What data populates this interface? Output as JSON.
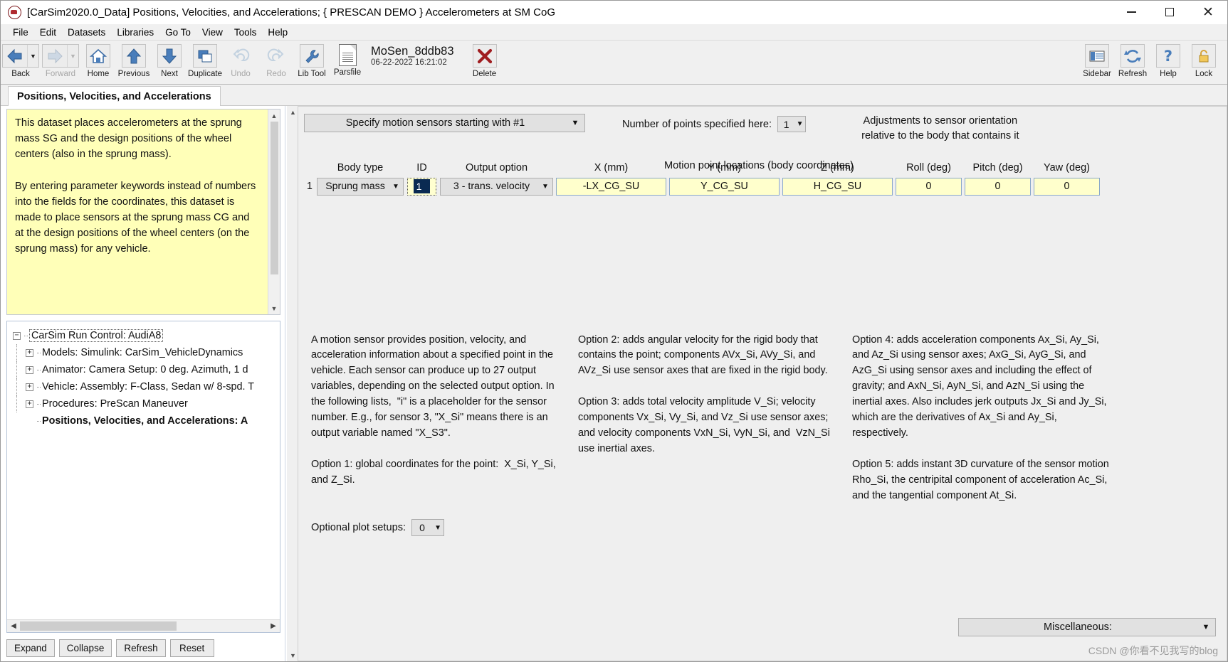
{
  "window": {
    "title": "[CarSim2020.0_Data] Positions, Velocities, and Accelerations; { PRESCAN DEMO } Accelerometers at SM CoG",
    "app_icon": "carsim-icon",
    "minimize": "minimize-icon",
    "maximize": "maximize-icon",
    "close": "close-icon"
  },
  "menu": [
    {
      "label": "File"
    },
    {
      "label": "Edit"
    },
    {
      "label": "Datasets"
    },
    {
      "label": "Libraries"
    },
    {
      "label": "Go To"
    },
    {
      "label": "View"
    },
    {
      "label": "Tools"
    },
    {
      "label": "Help"
    }
  ],
  "toolbar": {
    "back": "Back",
    "forward": "Forward",
    "home": "Home",
    "previous": "Previous",
    "next": "Next",
    "duplicate": "Duplicate",
    "undo": "Undo",
    "redo": "Redo",
    "lib_tool": "Lib Tool",
    "parsfile": "Parsfile",
    "file_name": "MoSen_8ddb83",
    "file_date": "06-22-2022 16:21:02",
    "delete": "Delete",
    "sidebar": "Sidebar",
    "refresh": "Refresh",
    "help": "Help",
    "lock": "Lock"
  },
  "tab": {
    "label": "Positions, Velocities, and Accelerations"
  },
  "description": {
    "text": "This dataset places accelerometers at the sprung mass SG and the design positions of the wheel centers (also in the sprung mass).\n\nBy entering parameter keywords instead of numbers into the fields for the coordinates, this dataset is made to place sensors at the sprung mass CG and at the design positions of the wheel centers (on the sprung mass) for any vehicle."
  },
  "tree": {
    "nodes": [
      {
        "label": "CarSim Run Control: AudiA8",
        "level": 1,
        "toggle": "minus",
        "selected": true,
        "bold": false
      },
      {
        "label": "Models: Simulink: CarSim_VehicleDynamics",
        "level": 2,
        "toggle": "plus",
        "selected": false,
        "bold": false
      },
      {
        "label": "Animator: Camera Setup: 0 deg. Azimuth, 1 d",
        "level": 2,
        "toggle": "plus",
        "selected": false,
        "bold": false
      },
      {
        "label": "Vehicle: Assembly: F-Class, Sedan w/ 8-spd. T",
        "level": 2,
        "toggle": "plus",
        "selected": false,
        "bold": false
      },
      {
        "label": "Procedures: PreScan Maneuver",
        "level": 2,
        "toggle": "plus",
        "selected": false,
        "bold": false
      },
      {
        "label": "Positions, Velocities, and Accelerations: A",
        "level": 2,
        "toggle": "none",
        "selected": false,
        "bold": true
      }
    ],
    "buttons": [
      {
        "label": "Expand"
      },
      {
        "label": "Collapse"
      },
      {
        "label": "Refresh"
      },
      {
        "label": "Reset"
      }
    ]
  },
  "main": {
    "sensor_mode_combo": "Specify motion sensors starting with #1",
    "num_points_label": "Number of points specified here:",
    "num_points_value": "1",
    "adjust_line1": "Adjustments to sensor orientation",
    "adjust_line2": "relative to the body that contains it",
    "motion_point_title": "Motion point locations (body coordinates)",
    "headers": {
      "body_type": "Body type",
      "id": "ID",
      "output_option": "Output option",
      "x": "X (mm)",
      "y": "Y (mm)",
      "z": "Z (mm)",
      "roll": "Roll (deg)",
      "pitch": "Pitch (deg)",
      "yaw": "Yaw (deg)"
    },
    "rows": [
      {
        "num": "1",
        "body_type": "Sprung mass",
        "id": "1",
        "output_option": "3 - trans. velocity",
        "x": "-LX_CG_SU",
        "y": "Y_CG_SU",
        "z": "H_CG_SU",
        "roll": "0",
        "pitch": "0",
        "yaw": "0"
      }
    ],
    "info_col1": "A motion sensor provides position, velocity, and acceleration information about a specified point in the vehicle. Each sensor can produce up to 27 output variables, depending on the selected output option. In the following lists,  \"i\" is a placeholder for the sensor number. E.g., for sensor 3, \"X_Si\" means there is an output variable named \"X_S3\".\n\nOption 1: global coordinates for the point:  X_Si, Y_Si, and Z_Si.",
    "info_col2": "Option 2: adds angular velocity for the rigid body that contains the point; components AVx_Si, AVy_Si, and AVz_Si use sensor axes that are fixed in the rigid body.\n\nOption 3: adds total velocity amplitude V_Si; velocity components Vx_Si, Vy_Si, and Vz_Si use sensor axes; and velocity components VxN_Si, VyN_Si, and  VzN_Si use inertial axes.",
    "info_col3": "Option 4: adds acceleration components Ax_Si, Ay_Si, and Az_Si using sensor axes; AxG_Si, AyG_Si, and AzG_Si using sensor axes and including the effect of gravity; and AxN_Si, AyN_Si, and AzN_Si using the inertial axes. Also includes jerk outputs Jx_Si and Jy_Si, which are the derivatives of Ax_Si and Ay_Si, respectively.\n\nOption 5: adds instant 3D curvature of the sensor motion Rho_Si, the centripital component of acceleration Ac_Si, and the tangential component At_Si.",
    "plot_setups_label": "Optional plot setups:",
    "plot_setups_value": "0",
    "misc_label": "Miscellaneous:"
  },
  "watermark": {
    "prefix": "CSDN ",
    "text": "@你看不见我写的blog"
  },
  "colors": {
    "yellow_field": "#ffffcc",
    "yellow_desc": "#ffffb8",
    "combo_bg": "#e1e1e1",
    "selection_navy": "#0a2a52",
    "toolbar_blue": "#4a7ebb",
    "delete_red": "#a01d20"
  }
}
